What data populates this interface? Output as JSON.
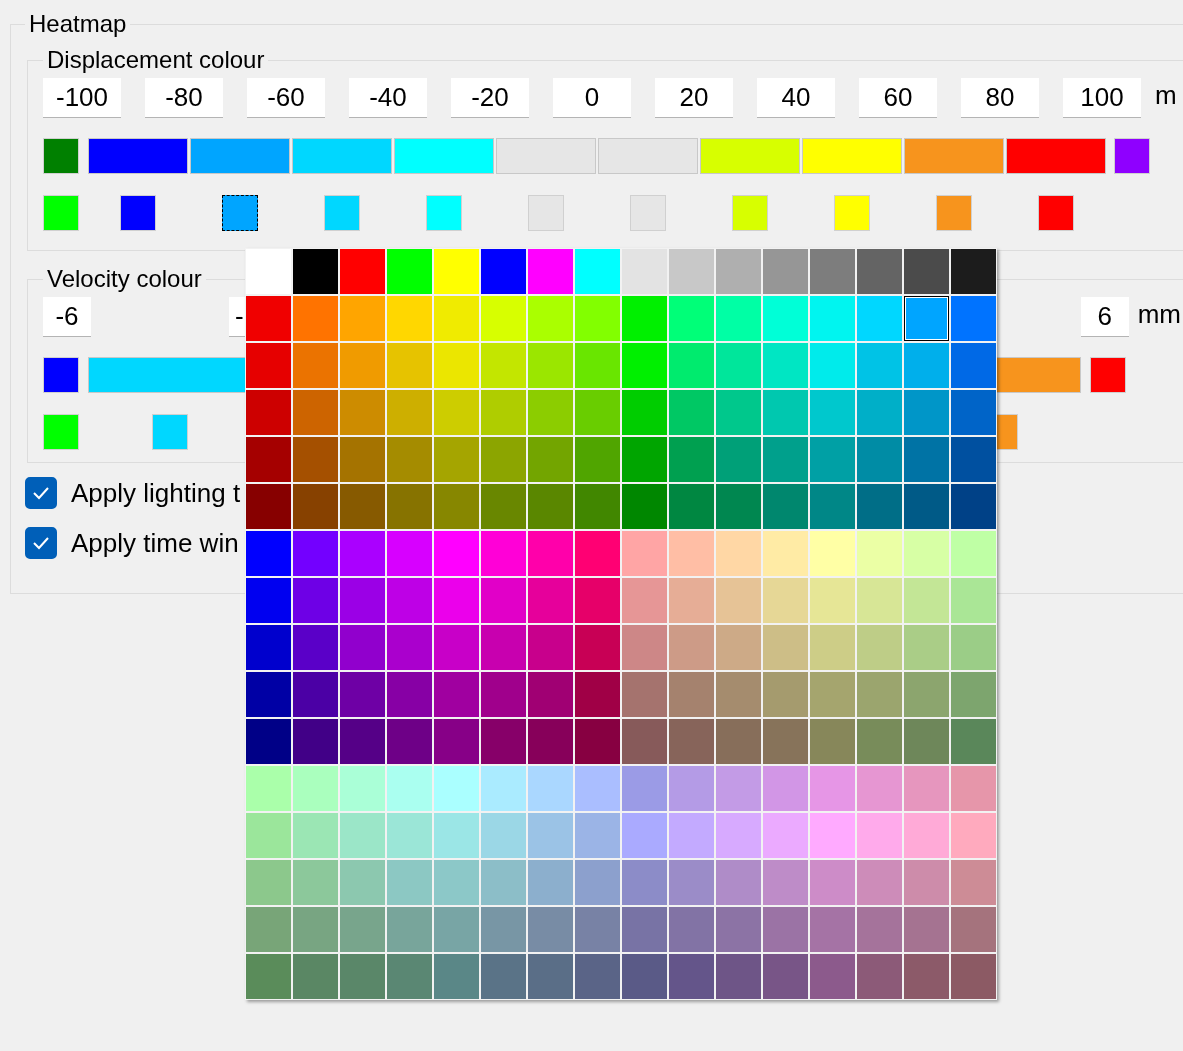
{
  "heatmap": {
    "title": "Heatmap",
    "displacement": {
      "title": "Displacement colour",
      "tick_labels": [
        "-100",
        "-80",
        "-60",
        "-40",
        "-20",
        "0",
        "20",
        "40",
        "60",
        "80",
        "100"
      ],
      "unit": "m",
      "below_swatch": {
        "color": "#008000"
      },
      "above_swatch": {
        "color": "#8f00ff"
      },
      "segments": [
        {
          "color": "#0000ff"
        },
        {
          "color": "#00a5ff"
        },
        {
          "color": "#00d7ff"
        },
        {
          "color": "#00ffff"
        },
        {
          "color": "#e6e6e6"
        },
        {
          "color": "#e6e6e6"
        },
        {
          "color": "#d7ff00"
        },
        {
          "color": "#ffff00"
        },
        {
          "color": "#f7941d"
        },
        {
          "color": "#ff0000"
        }
      ],
      "markers": [
        {
          "color": "#00ff00",
          "selected": false
        },
        {
          "color": "#0000ff",
          "selected": false
        },
        {
          "color": "#00a5ff",
          "selected": true
        },
        {
          "color": "#00d7ff",
          "selected": false
        },
        {
          "color": "#00ffff",
          "selected": false
        },
        {
          "color": "#e6e6e6",
          "selected": false
        },
        {
          "color": "#e6e6e6",
          "selected": false
        },
        {
          "color": "#d7ff00",
          "selected": false
        },
        {
          "color": "#ffff00",
          "selected": false
        },
        {
          "color": "#f7941d",
          "selected": false
        },
        {
          "color": "#ff0000",
          "selected": false
        }
      ]
    },
    "velocity": {
      "title": "Velocity colour",
      "tick_labels": [
        "-6",
        "-",
        "6"
      ],
      "unit": "mm",
      "below_swatch": {
        "color": "#0000ff"
      },
      "above_swatch": {
        "color": "#ff0000"
      },
      "segments": [
        {
          "color": "#00d7ff"
        },
        {
          "color": "#f7941d"
        }
      ],
      "markers": [
        {
          "color": "#00ff00",
          "selected": false
        },
        {
          "color": "#00d7ff",
          "selected": false
        },
        {
          "color": "#f7941d",
          "selected": false
        }
      ]
    },
    "options": [
      {
        "label": "Apply lighting t",
        "checked": true
      },
      {
        "label": "Apply time win",
        "checked": true
      }
    ]
  },
  "palette": {
    "rows": [
      [
        {
          "color": "#ffffff",
          "selected": false
        },
        {
          "color": "#000000",
          "selected": false
        },
        {
          "color": "#ff0000",
          "selected": false
        },
        {
          "color": "#00ff00",
          "selected": false
        },
        {
          "color": "#ffff00",
          "selected": false
        },
        {
          "color": "#0000ff",
          "selected": false
        },
        {
          "color": "#ff00ff",
          "selected": false
        },
        {
          "color": "#00ffff",
          "selected": false
        },
        {
          "color": "#e3e3e3",
          "selected": false
        },
        {
          "color": "#c8c8c8",
          "selected": false
        },
        {
          "color": "#afafaf",
          "selected": false
        },
        {
          "color": "#969696",
          "selected": false
        },
        {
          "color": "#7d7d7d",
          "selected": false
        },
        {
          "color": "#646464",
          "selected": false
        },
        {
          "color": "#4b4b4b",
          "selected": false
        },
        {
          "color": "#1c1c1c",
          "selected": false
        }
      ],
      [
        {
          "color": "#f00000",
          "selected": false
        },
        {
          "color": "#ff7300",
          "selected": false
        },
        {
          "color": "#ffa500",
          "selected": false
        },
        {
          "color": "#ffd700",
          "selected": false
        },
        {
          "color": "#f0eb00",
          "selected": false
        },
        {
          "color": "#d7ff00",
          "selected": false
        },
        {
          "color": "#aaff00",
          "selected": false
        },
        {
          "color": "#82ff00",
          "selected": false
        },
        {
          "color": "#00f000",
          "selected": false
        },
        {
          "color": "#00ff78",
          "selected": false
        },
        {
          "color": "#00ffa5",
          "selected": false
        },
        {
          "color": "#00ffd7",
          "selected": false
        },
        {
          "color": "#00f5f0",
          "selected": false
        },
        {
          "color": "#00d7ff",
          "selected": false
        },
        {
          "color": "#00a5ff",
          "selected": true
        },
        {
          "color": "#0073ff",
          "selected": false
        }
      ],
      [
        {
          "color": "#e60000",
          "selected": false
        },
        {
          "color": "#eb7300",
          "selected": false
        },
        {
          "color": "#f09b00",
          "selected": false
        },
        {
          "color": "#e6c300",
          "selected": false
        },
        {
          "color": "#ebe600",
          "selected": false
        },
        {
          "color": "#c3e600",
          "selected": false
        },
        {
          "color": "#9be600",
          "selected": false
        },
        {
          "color": "#69e600",
          "selected": false
        },
        {
          "color": "#00f000",
          "selected": false
        },
        {
          "color": "#00eb6e",
          "selected": false
        },
        {
          "color": "#00e69b",
          "selected": false
        },
        {
          "color": "#00e6c3",
          "selected": false
        },
        {
          "color": "#00ebeb",
          "selected": false
        },
        {
          "color": "#00c3e6",
          "selected": false
        },
        {
          "color": "#00afeb",
          "selected": false
        },
        {
          "color": "#0069e6",
          "selected": false
        }
      ],
      [
        {
          "color": "#cd0000",
          "selected": false
        },
        {
          "color": "#cd6400",
          "selected": false
        },
        {
          "color": "#cd8c00",
          "selected": false
        },
        {
          "color": "#cdaf00",
          "selected": false
        },
        {
          "color": "#cdcd00",
          "selected": false
        },
        {
          "color": "#afcd00",
          "selected": false
        },
        {
          "color": "#8ccd00",
          "selected": false
        },
        {
          "color": "#69cd00",
          "selected": false
        },
        {
          "color": "#00cd00",
          "selected": false
        },
        {
          "color": "#00c864",
          "selected": false
        },
        {
          "color": "#00c88c",
          "selected": false
        },
        {
          "color": "#00c8af",
          "selected": false
        },
        {
          "color": "#00c8cd",
          "selected": false
        },
        {
          "color": "#00afc8",
          "selected": false
        },
        {
          "color": "#0096c8",
          "selected": false
        },
        {
          "color": "#0064c8",
          "selected": false
        }
      ],
      [
        {
          "color": "#a50000",
          "selected": false
        },
        {
          "color": "#a55000",
          "selected": false
        },
        {
          "color": "#a57300",
          "selected": false
        },
        {
          "color": "#a58c00",
          "selected": false
        },
        {
          "color": "#a5a500",
          "selected": false
        },
        {
          "color": "#8ca500",
          "selected": false
        },
        {
          "color": "#73a500",
          "selected": false
        },
        {
          "color": "#50a500",
          "selected": false
        },
        {
          "color": "#00a500",
          "selected": false
        },
        {
          "color": "#00a050",
          "selected": false
        },
        {
          "color": "#00a078",
          "selected": false
        },
        {
          "color": "#00a08c",
          "selected": false
        },
        {
          "color": "#00a0a5",
          "selected": false
        },
        {
          "color": "#008ca5",
          "selected": false
        },
        {
          "color": "#0073a5",
          "selected": false
        },
        {
          "color": "#0050a0",
          "selected": false
        }
      ],
      [
        {
          "color": "#870000",
          "selected": false
        },
        {
          "color": "#874100",
          "selected": false
        },
        {
          "color": "#875a00",
          "selected": false
        },
        {
          "color": "#877300",
          "selected": false
        },
        {
          "color": "#878700",
          "selected": false
        },
        {
          "color": "#698700",
          "selected": false
        },
        {
          "color": "#5a8700",
          "selected": false
        },
        {
          "color": "#418700",
          "selected": false
        },
        {
          "color": "#008700",
          "selected": false
        },
        {
          "color": "#008741",
          "selected": false
        },
        {
          "color": "#008750",
          "selected": false
        },
        {
          "color": "#00876e",
          "selected": false
        },
        {
          "color": "#008787",
          "selected": false
        },
        {
          "color": "#006e87",
          "selected": false
        },
        {
          "color": "#005a87",
          "selected": false
        },
        {
          "color": "#004187",
          "selected": false
        }
      ],
      [
        {
          "color": "#0000ff",
          "selected": false
        },
        {
          "color": "#7300ff",
          "selected": false
        },
        {
          "color": "#aa00ff",
          "selected": false
        },
        {
          "color": "#d700ff",
          "selected": false
        },
        {
          "color": "#ff00ff",
          "selected": false
        },
        {
          "color": "#ff00d7",
          "selected": false
        },
        {
          "color": "#ff00aa",
          "selected": false
        },
        {
          "color": "#ff0073",
          "selected": false
        },
        {
          "color": "#ffa5a5",
          "selected": false
        },
        {
          "color": "#ffbea5",
          "selected": false
        },
        {
          "color": "#ffd7a5",
          "selected": false
        },
        {
          "color": "#ffeba5",
          "selected": false
        },
        {
          "color": "#ffffa5",
          "selected": false
        },
        {
          "color": "#ebffa5",
          "selected": false
        },
        {
          "color": "#d7ffa5",
          "selected": false
        },
        {
          "color": "#bfffa5",
          "selected": false
        }
      ],
      [
        {
          "color": "#0000f0",
          "selected": false
        },
        {
          "color": "#6e00e6",
          "selected": false
        },
        {
          "color": "#9b00e6",
          "selected": false
        },
        {
          "color": "#be00e6",
          "selected": false
        },
        {
          "color": "#eb00eb",
          "selected": false
        },
        {
          "color": "#e100c8",
          "selected": false
        },
        {
          "color": "#e6009b",
          "selected": false
        },
        {
          "color": "#e60069",
          "selected": false
        },
        {
          "color": "#e69696",
          "selected": false
        },
        {
          "color": "#e6ad96",
          "selected": false
        },
        {
          "color": "#e6c396",
          "selected": false
        },
        {
          "color": "#e6d796",
          "selected": false
        },
        {
          "color": "#e6e696",
          "selected": false
        },
        {
          "color": "#d7e696",
          "selected": false
        },
        {
          "color": "#c3e696",
          "selected": false
        },
        {
          "color": "#aae696",
          "selected": false
        }
      ],
      [
        {
          "color": "#0000cd",
          "selected": false
        },
        {
          "color": "#5a00c8",
          "selected": false
        },
        {
          "color": "#9100cd",
          "selected": false
        },
        {
          "color": "#aa00cd",
          "selected": false
        },
        {
          "color": "#c800c8",
          "selected": false
        },
        {
          "color": "#c800af",
          "selected": false
        },
        {
          "color": "#c8008c",
          "selected": false
        },
        {
          "color": "#c80055",
          "selected": false
        },
        {
          "color": "#cd8787",
          "selected": false
        },
        {
          "color": "#cd9b87",
          "selected": false
        },
        {
          "color": "#cdaa87",
          "selected": false
        },
        {
          "color": "#cdbe87",
          "selected": false
        },
        {
          "color": "#cdcd87",
          "selected": false
        },
        {
          "color": "#becd87",
          "selected": false
        },
        {
          "color": "#aacd87",
          "selected": false
        },
        {
          "color": "#9bcd87",
          "selected": false
        }
      ],
      [
        {
          "color": "#0000a5",
          "selected": false
        },
        {
          "color": "#4b00a5",
          "selected": false
        },
        {
          "color": "#6e00a5",
          "selected": false
        },
        {
          "color": "#8700a5",
          "selected": false
        },
        {
          "color": "#a000a0",
          "selected": false
        },
        {
          "color": "#a0008c",
          "selected": false
        },
        {
          "color": "#a00073",
          "selected": false
        },
        {
          "color": "#a00046",
          "selected": false
        },
        {
          "color": "#a5736e",
          "selected": false
        },
        {
          "color": "#a5826e",
          "selected": false
        },
        {
          "color": "#a58c6e",
          "selected": false
        },
        {
          "color": "#a59b6e",
          "selected": false
        },
        {
          "color": "#a5a56e",
          "selected": false
        },
        {
          "color": "#9ba56e",
          "selected": false
        },
        {
          "color": "#8ca56e",
          "selected": false
        },
        {
          "color": "#7da56e",
          "selected": false
        }
      ],
      [
        {
          "color": "#000087",
          "selected": false
        },
        {
          "color": "#410087",
          "selected": false
        },
        {
          "color": "#550087",
          "selected": false
        },
        {
          "color": "#6e0087",
          "selected": false
        },
        {
          "color": "#870087",
          "selected": false
        },
        {
          "color": "#870069",
          "selected": false
        },
        {
          "color": "#87005a",
          "selected": false
        },
        {
          "color": "#870041",
          "selected": false
        },
        {
          "color": "#875a5a",
          "selected": false
        },
        {
          "color": "#87645a",
          "selected": false
        },
        {
          "color": "#876e5a",
          "selected": false
        },
        {
          "color": "#87735a",
          "selected": false
        },
        {
          "color": "#87875a",
          "selected": false
        },
        {
          "color": "#788c5a",
          "selected": false
        },
        {
          "color": "#6e875a",
          "selected": false
        },
        {
          "color": "#5a875a",
          "selected": false
        }
      ],
      [
        {
          "color": "#aaffaa",
          "selected": false
        },
        {
          "color": "#aaffbe",
          "selected": false
        },
        {
          "color": "#aaffd7",
          "selected": false
        },
        {
          "color": "#aafff0",
          "selected": false
        },
        {
          "color": "#aaffff",
          "selected": false
        },
        {
          "color": "#aaebff",
          "selected": false
        },
        {
          "color": "#aad7ff",
          "selected": false
        },
        {
          "color": "#aabeff",
          "selected": false
        },
        {
          "color": "#9b9be6",
          "selected": false
        },
        {
          "color": "#b49be6",
          "selected": false
        },
        {
          "color": "#c39be6",
          "selected": false
        },
        {
          "color": "#d296e6",
          "selected": false
        },
        {
          "color": "#e696e6",
          "selected": false
        },
        {
          "color": "#e696d2",
          "selected": false
        },
        {
          "color": "#e696be",
          "selected": false
        },
        {
          "color": "#e696aa",
          "selected": false
        }
      ],
      [
        {
          "color": "#9be69b",
          "selected": false
        },
        {
          "color": "#9be6b4",
          "selected": false
        },
        {
          "color": "#9be6c8",
          "selected": false
        },
        {
          "color": "#9be6d7",
          "selected": false
        },
        {
          "color": "#9be6e6",
          "selected": false
        },
        {
          "color": "#9bd7e6",
          "selected": false
        },
        {
          "color": "#9bc3e6",
          "selected": false
        },
        {
          "color": "#9bb4e6",
          "selected": false
        },
        {
          "color": "#aaaaff",
          "selected": false
        },
        {
          "color": "#c3aaff",
          "selected": false
        },
        {
          "color": "#d7aaff",
          "selected": false
        },
        {
          "color": "#ebaaff",
          "selected": false
        },
        {
          "color": "#ffaaff",
          "selected": false
        },
        {
          "color": "#ffaaeb",
          "selected": false
        },
        {
          "color": "#ffaad7",
          "selected": false
        },
        {
          "color": "#ffaabe",
          "selected": false
        }
      ],
      [
        {
          "color": "#8cc88c",
          "selected": false
        },
        {
          "color": "#8cc89b",
          "selected": false
        },
        {
          "color": "#8cc8af",
          "selected": false
        },
        {
          "color": "#8cc8c3",
          "selected": false
        },
        {
          "color": "#8cc8c8",
          "selected": false
        },
        {
          "color": "#8cbec8",
          "selected": false
        },
        {
          "color": "#8cafcd",
          "selected": false
        },
        {
          "color": "#8ca0cd",
          "selected": false
        },
        {
          "color": "#8c8cc8",
          "selected": false
        },
        {
          "color": "#9b8cc8",
          "selected": false
        },
        {
          "color": "#af8cc8",
          "selected": false
        },
        {
          "color": "#be8cc8",
          "selected": false
        },
        {
          "color": "#cd8cc8",
          "selected": false
        },
        {
          "color": "#cd8cb9",
          "selected": false
        },
        {
          "color": "#cd8caa",
          "selected": false
        },
        {
          "color": "#cd8c96",
          "selected": false
        }
      ],
      [
        {
          "color": "#78a578",
          "selected": false
        },
        {
          "color": "#78a582",
          "selected": false
        },
        {
          "color": "#78a58c",
          "selected": false
        },
        {
          "color": "#78a59b",
          "selected": false
        },
        {
          "color": "#78a5a5",
          "selected": false
        },
        {
          "color": "#7896a5",
          "selected": false
        },
        {
          "color": "#788ca5",
          "selected": false
        },
        {
          "color": "#7882a5",
          "selected": false
        },
        {
          "color": "#7873a5",
          "selected": false
        },
        {
          "color": "#8273a5",
          "selected": false
        },
        {
          "color": "#8c73a5",
          "selected": false
        },
        {
          "color": "#9b73a5",
          "selected": false
        },
        {
          "color": "#a573a5",
          "selected": false
        },
        {
          "color": "#a5739b",
          "selected": false
        },
        {
          "color": "#a57391",
          "selected": false
        },
        {
          "color": "#a5737d",
          "selected": false
        }
      ],
      [
        {
          "color": "#5a8c5a",
          "selected": false
        },
        {
          "color": "#5a8764",
          "selected": false
        },
        {
          "color": "#5a8769",
          "selected": false
        },
        {
          "color": "#5a8773",
          "selected": false
        },
        {
          "color": "#5a8787",
          "selected": false
        },
        {
          "color": "#5a7387",
          "selected": false
        },
        {
          "color": "#5a6e87",
          "selected": false
        },
        {
          "color": "#5a6487",
          "selected": false
        },
        {
          "color": "#5a5a87",
          "selected": false
        },
        {
          "color": "#64558a",
          "selected": false
        },
        {
          "color": "#6e5587",
          "selected": false
        },
        {
          "color": "#785587",
          "selected": false
        },
        {
          "color": "#8c5a8c",
          "selected": false
        },
        {
          "color": "#8c5a78",
          "selected": false
        },
        {
          "color": "#8c5a69",
          "selected": false
        },
        {
          "color": "#8c5a64",
          "selected": false
        }
      ]
    ]
  }
}
